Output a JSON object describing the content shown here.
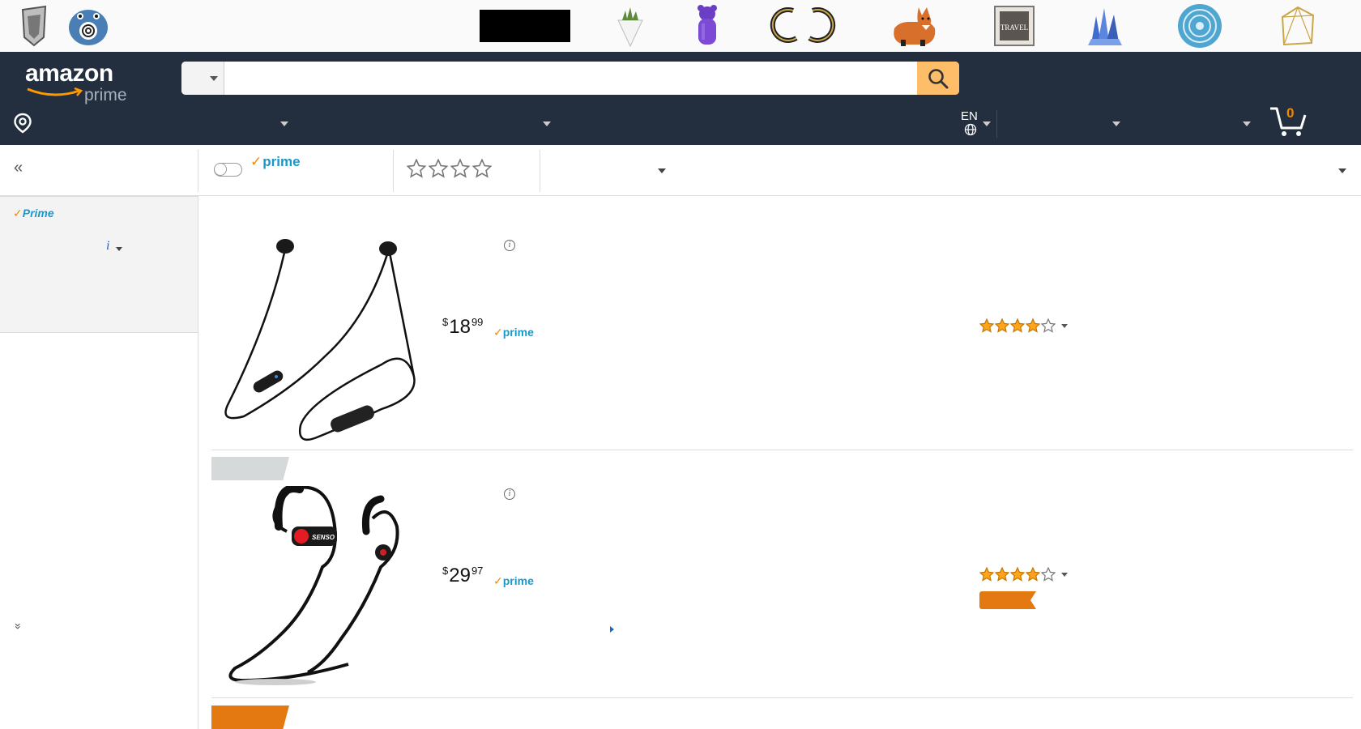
{
  "deals_strip": {
    "items": [
      "mirror-art",
      "pokemon-plush",
      "redacted-banner",
      "hanging-planter",
      "gummy-bear-lamp",
      "moon-hoop-earrings",
      "fox-plush",
      "travel-frame",
      "crystal-cluster",
      "mandala-blanket",
      "geometric-terrarium"
    ],
    "redacted_color": "#000000"
  },
  "header": {
    "logo_word": "amazon",
    "logo_sub": "prime",
    "search": {
      "placeholder": "",
      "value": ""
    },
    "language": "EN",
    "cart_count": "0",
    "colors": {
      "bar": "#232f3e",
      "search_button": "#febd69",
      "cart_count": "#f08804"
    }
  },
  "filterbar": {
    "prime_check": "✓",
    "prime_label": "prime",
    "stars_filter": 0,
    "stars_max": 4
  },
  "sidebar": {
    "prime_check": "✓",
    "prime_label": "Prime",
    "info_glyph": "i"
  },
  "results": [
    {
      "price_currency": "$",
      "price_whole": "18",
      "price_cents": "99",
      "prime_check": "✓",
      "prime_label": "prime",
      "info_glyph": "i",
      "rating": 4,
      "rating_max": 5,
      "image": "black-neckband-earbuds"
    },
    {
      "price_currency": "$",
      "price_whole": "29",
      "price_cents": "97",
      "prime_check": "✓",
      "prime_label": "prime",
      "info_glyph": "i",
      "rating": 4,
      "rating_max": 5,
      "image": "senso-ear-hook-earbuds",
      "sponsored_tag_color": "#d5d9d9",
      "bestseller_tag_color": "#e47911"
    }
  ],
  "glyphs": {
    "collapse": "«",
    "expand": "»"
  }
}
